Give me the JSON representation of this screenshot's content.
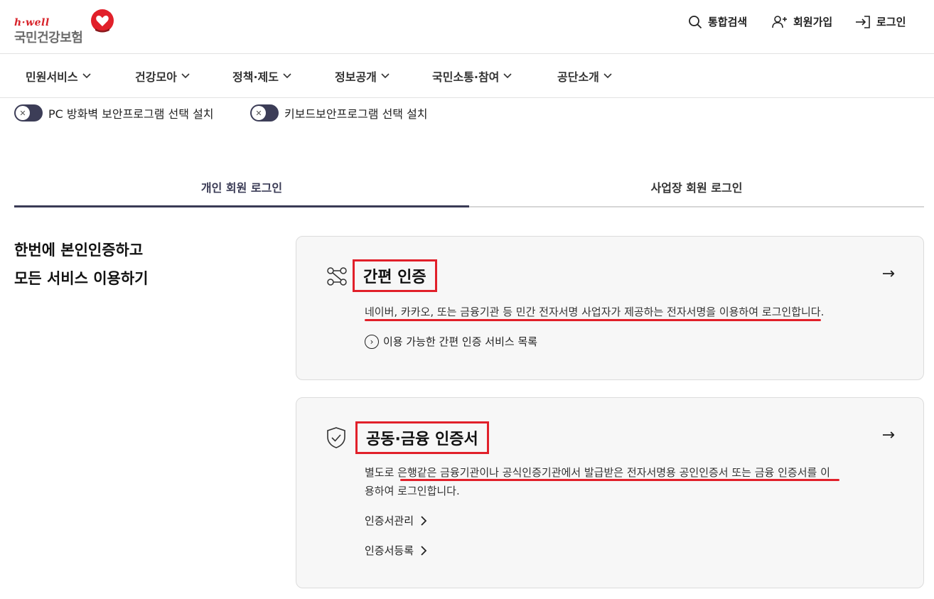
{
  "logo": {
    "brand": "h·well",
    "name": "국민건강보험"
  },
  "utility": {
    "search": "통합검색",
    "join": "회원가입",
    "login": "로그인"
  },
  "gnb": [
    {
      "label": "민원서비스"
    },
    {
      "label": "건강모아"
    },
    {
      "label": "정책·제도"
    },
    {
      "label": "정보공개"
    },
    {
      "label": "국민소통·참여"
    },
    {
      "label": "공단소개"
    }
  ],
  "toggles": [
    {
      "label": "PC 방화벽 보안프로그램 선택 설치"
    },
    {
      "label": "키보드보안프로그램 선택 설치"
    }
  ],
  "tabs": {
    "personal": "개인 회원 로그인",
    "business": "사업장 회원 로그인"
  },
  "intro": {
    "line1": "한번에 본인인증하고",
    "line2": "모든 서비스 이용하기"
  },
  "simple_auth": {
    "title": "간편 인증",
    "desc": "네이버, 카카오, 또는 금융기관 등 민간 전자서명 사업자가 제공하는 전자서명을 이용하여 로그인합니다.",
    "link": "이용 가능한 간편 인증 서비스 목록"
  },
  "cert_auth": {
    "title": "공동·금융 인증서",
    "desc_line1": "별도로 은행같은 금융기관이나 공식인증기관에서 발급받은 전자서명용 공인인증서 또는 금융 인증서를 이",
    "desc_line2": "용하여 로그인합니다.",
    "link1": "인증서관리",
    "link2": "인증서등록"
  },
  "colors": {
    "accent_dark": "#3a3b55",
    "highlight_red": "#e1202a",
    "card_bg": "#f7f7f7"
  }
}
